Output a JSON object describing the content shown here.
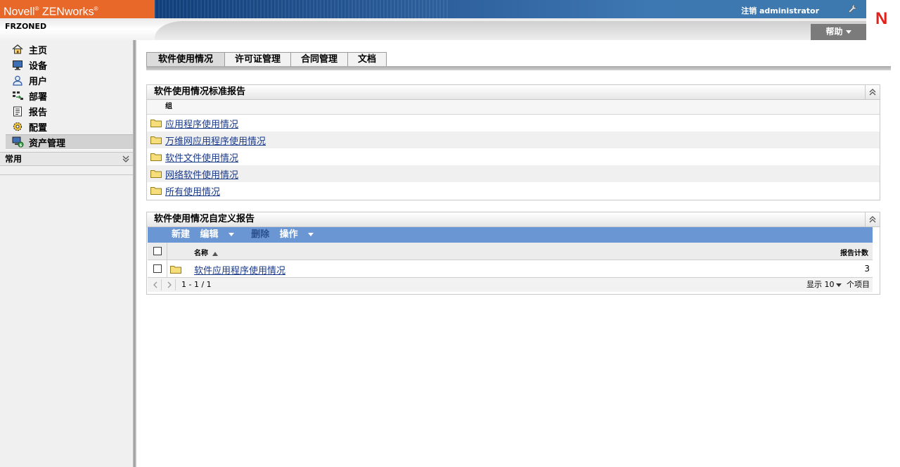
{
  "header": {
    "brand": "Novell",
    "product": "ZENworks",
    "zone": "FRZONED",
    "logout": "注销 administrator",
    "help": "帮助",
    "logo_letter": "N",
    "colors": {
      "brand": "#e8682a",
      "logo": "#e2201b"
    }
  },
  "sidebar": {
    "items": [
      {
        "label": "主页",
        "icon": "home-icon"
      },
      {
        "label": "设备",
        "icon": "monitor-icon"
      },
      {
        "label": "用户",
        "icon": "user-icon"
      },
      {
        "label": "部署",
        "icon": "deploy-icon"
      },
      {
        "label": "报告",
        "icon": "report-icon"
      },
      {
        "label": "配置",
        "icon": "config-gear-icon"
      },
      {
        "label": "资产管理",
        "icon": "asset-management-icon",
        "active": true
      }
    ],
    "common": "常用"
  },
  "tabs": [
    "软件使用情况",
    "许可证管理",
    "合同管理",
    "文档"
  ],
  "standard_panel": {
    "title": "软件使用情况标准报告",
    "column": "组",
    "rows": [
      "应用程序使用情况",
      "万维网应用程序使用情况",
      "软件文件使用情况",
      "网络软件使用情况",
      "所有使用情况"
    ]
  },
  "custom_panel": {
    "title": "软件使用情况自定义报告",
    "toolbar": {
      "new": "新建",
      "edit": "编辑",
      "delete": "删除",
      "actions": "操作"
    },
    "columns": {
      "name": "名称",
      "count": "报告计数"
    },
    "rows": [
      {
        "name": "软件应用程序使用情况",
        "count": "3"
      }
    ],
    "pager": {
      "range": "1 - 1 / 1",
      "show": "显示",
      "per_page": "10",
      "items_suffix": "个项目"
    }
  }
}
